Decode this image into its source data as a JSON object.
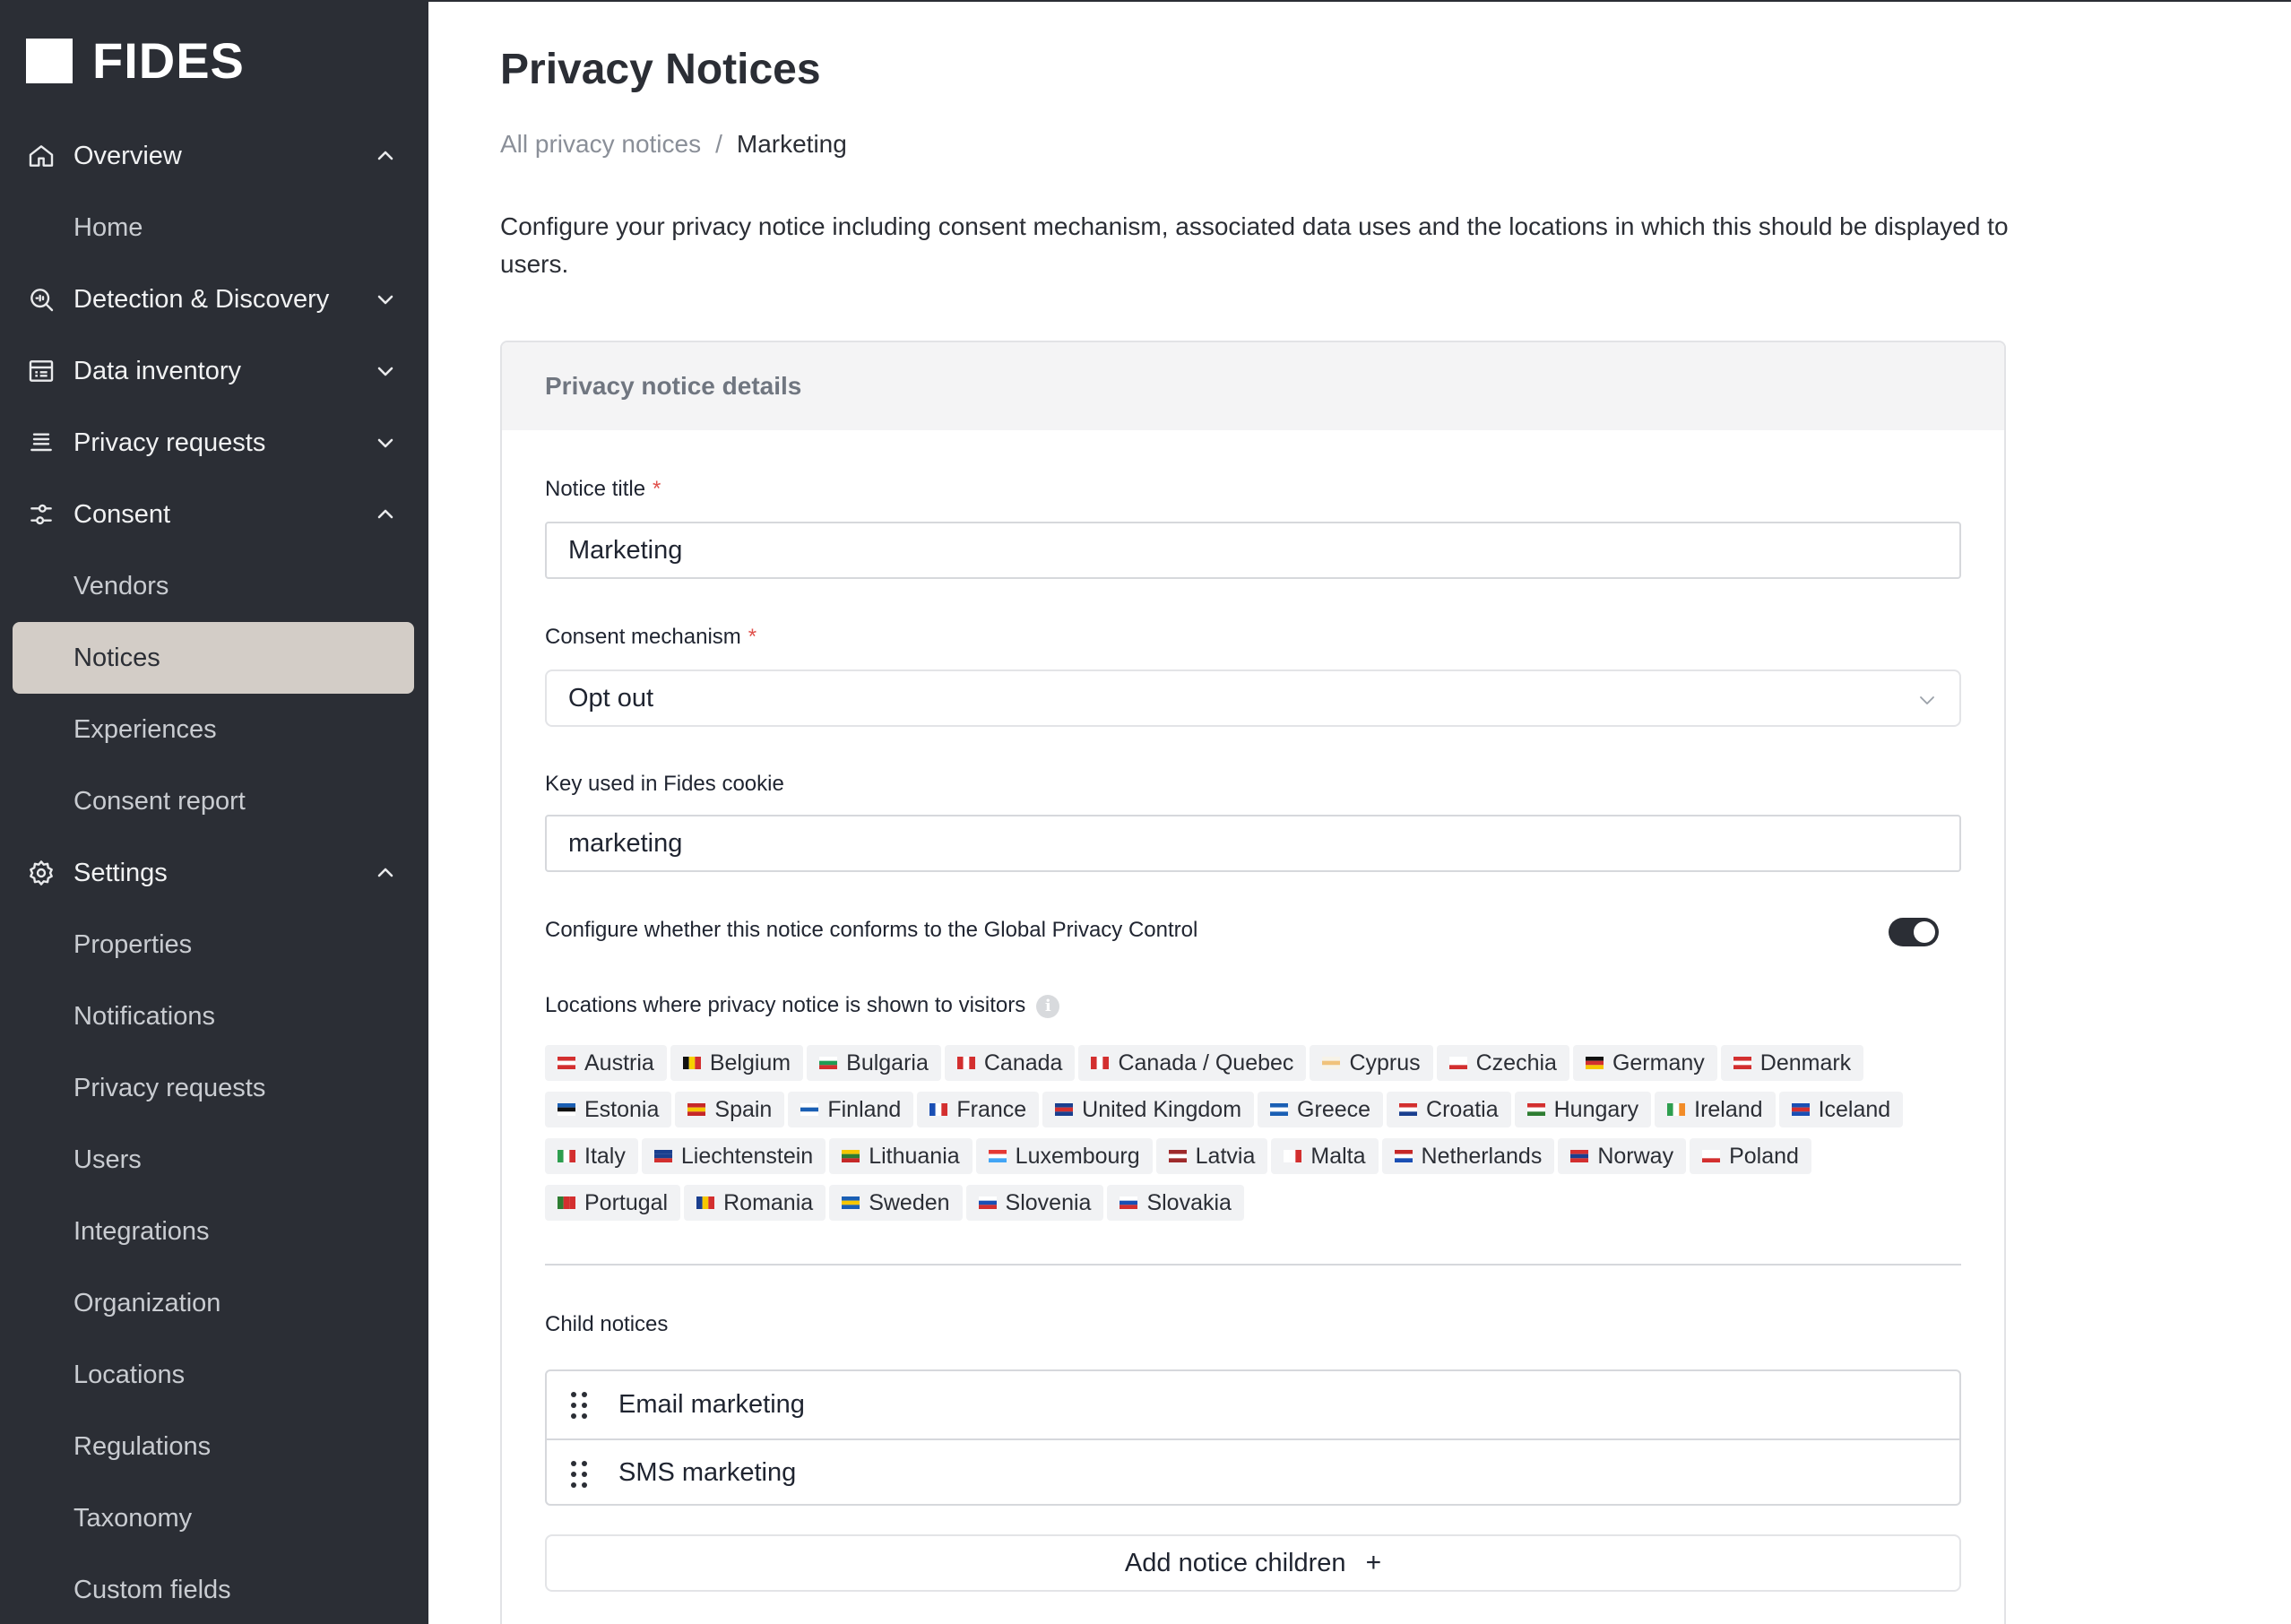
{
  "brand": {
    "name": "FIDES"
  },
  "sidebar": {
    "items": [
      {
        "label": "Overview",
        "icon": "home-icon",
        "expanded": true
      },
      {
        "label": "Home",
        "sub": true
      },
      {
        "label": "Detection & Discovery",
        "icon": "radar-icon",
        "expanded": false
      },
      {
        "label": "Data inventory",
        "icon": "table-icon",
        "expanded": false
      },
      {
        "label": "Privacy requests",
        "icon": "list-icon",
        "expanded": false
      },
      {
        "label": "Consent",
        "icon": "sliders-icon",
        "expanded": true
      },
      {
        "label": "Vendors",
        "sub": true
      },
      {
        "label": "Notices",
        "sub": true,
        "active": true
      },
      {
        "label": "Experiences",
        "sub": true
      },
      {
        "label": "Consent report",
        "sub": true
      },
      {
        "label": "Settings",
        "icon": "gear-icon",
        "expanded": true
      },
      {
        "label": "Properties",
        "sub": true
      },
      {
        "label": "Notifications",
        "sub": true
      },
      {
        "label": "Privacy requests",
        "sub": true
      },
      {
        "label": "Users",
        "sub": true
      },
      {
        "label": "Integrations",
        "sub": true
      },
      {
        "label": "Organization",
        "sub": true
      },
      {
        "label": "Locations",
        "sub": true
      },
      {
        "label": "Regulations",
        "sub": true
      },
      {
        "label": "Taxonomy",
        "sub": true
      },
      {
        "label": "Custom fields",
        "sub": true
      }
    ]
  },
  "page": {
    "title": "Privacy Notices",
    "breadcrumb": {
      "parent": "All privacy notices",
      "separator": "/",
      "current": "Marketing"
    },
    "description": "Configure your privacy notice including consent mechanism, associated data uses and the locations in which this should be displayed to users."
  },
  "form": {
    "header": "Privacy notice details",
    "notice_title": {
      "label": "Notice title",
      "required": "*",
      "value": "Marketing"
    },
    "consent_mechanism": {
      "label": "Consent mechanism",
      "required": "*",
      "value": "Opt out"
    },
    "cookie_key": {
      "label": "Key used in Fides cookie",
      "value": "marketing"
    },
    "gpc": {
      "label": "Configure whether this notice conforms to the Global Privacy Control",
      "enabled": true
    },
    "locations": {
      "label": "Locations where privacy notice is shown to visitors",
      "rows": [
        [
          "Austria",
          "Belgium",
          "Bulgaria",
          "Canada",
          "Canada / Quebec",
          "Cyprus",
          "Czechia",
          "Germany",
          "Denmark"
        ],
        [
          "Estonia",
          "Spain",
          "Finland",
          "France",
          "United Kingdom",
          "Greece",
          "Croatia",
          "Hungary",
          "Ireland",
          "Iceland"
        ],
        [
          "Italy",
          "Liechtenstein",
          "Lithuania",
          "Luxembourg",
          "Latvia",
          "Malta",
          "Netherlands",
          "Norway",
          "Poland"
        ],
        [
          "Portugal",
          "Romania",
          "Sweden",
          "Slovenia",
          "Slovakia"
        ]
      ]
    },
    "child_notices": {
      "label": "Child notices",
      "items": [
        "Email marketing",
        "SMS marketing"
      ],
      "add_label": "Add notice children",
      "add_icon": "+"
    }
  },
  "colors": {
    "sidebar_bg": "#2b2e35",
    "active_item_bg": "#d3cdc7",
    "required": "#e0504b",
    "toggle_on": "#2b2e35"
  }
}
